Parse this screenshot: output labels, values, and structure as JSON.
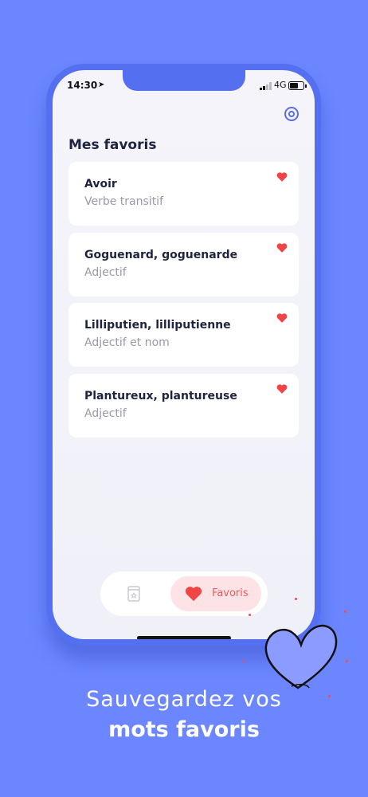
{
  "status_bar": {
    "time": "14:30",
    "network": "4G"
  },
  "page": {
    "title": "Mes favoris"
  },
  "favorites": [
    {
      "word": "Avoir",
      "category": "Verbe transitif"
    },
    {
      "word": "Goguenard, goguenarde",
      "category": "Adjectif"
    },
    {
      "word": "Lilliputien, lilliputienne",
      "category": "Adjectif et nom"
    },
    {
      "word": "Plantureux, plantureuse",
      "category": "Adjectif"
    }
  ],
  "tab_bar": {
    "favorites_label": "Favoris"
  },
  "caption": {
    "line1": "Sauvegardez vos",
    "line2": "mots favoris"
  },
  "colors": {
    "background": "#6B86FF",
    "accent": "#5470F0",
    "heart": "#F24444"
  },
  "icons": [
    "location-arrow-icon",
    "signal-icon",
    "battery-icon",
    "settings-icon",
    "heart-icon",
    "dictionary-icon"
  ]
}
